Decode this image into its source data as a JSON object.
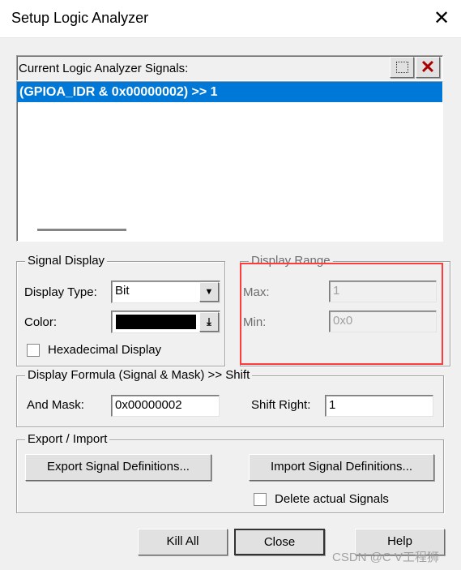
{
  "window": {
    "title": "Setup Logic Analyzer"
  },
  "signals": {
    "label": "Current Logic Analyzer Signals:",
    "items": [
      "(GPIOA_IDR & 0x00000002) >> 1"
    ],
    "selected_color": "#0078d7"
  },
  "signal_display": {
    "legend": "Signal Display",
    "display_type_label": "Display Type:",
    "display_type_value": "Bit",
    "color_label": "Color:",
    "color_value": "#000000",
    "hex_label": "Hexadecimal Display",
    "hex_checked": false
  },
  "display_range": {
    "legend": "Display Range",
    "max_label": "Max:",
    "max_value": "1",
    "min_label": "Min:",
    "min_value": "0x0",
    "highlight_color": "#ff3b3b"
  },
  "formula": {
    "legend": "Display Formula (Signal & Mask) >> Shift",
    "and_mask_label": "And Mask:",
    "and_mask_value": "0x00000002",
    "shift_label": "Shift Right:",
    "shift_value": "1"
  },
  "export_import": {
    "legend": "Export / Import",
    "export_label": "Export Signal Definitions...",
    "import_label": "Import Signal Definitions...",
    "delete_label": "Delete actual Signals",
    "delete_checked": false
  },
  "buttons": {
    "kill_all": "Kill All",
    "close": "Close",
    "help": "Help"
  },
  "watermark": "CSDN @C V工程狮"
}
